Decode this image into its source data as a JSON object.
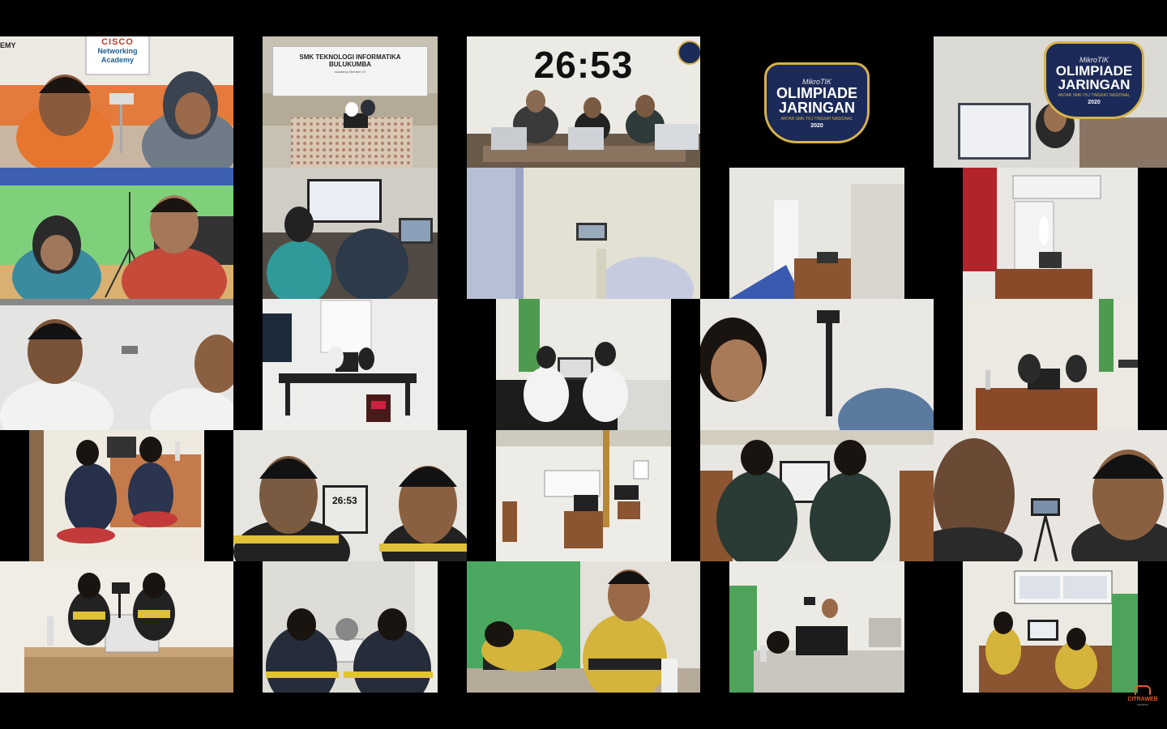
{
  "meeting": {
    "view": "gallery",
    "participant_count": 25
  },
  "timer": {
    "main": "26:53",
    "in_tile": "26:53"
  },
  "banners": {
    "school_line1": "SMK TEKNOLOGI INFORMATIKA",
    "school_line2": "BULUKUMBA",
    "school_line3": "Academy Member Of",
    "cisco_logo": "CISCO",
    "cisco_line1": "Networking",
    "cisco_line2": "Academy",
    "emy": "EMY"
  },
  "badge": {
    "brand": "MikroTIK",
    "line1": "OLIMPIADE",
    "line2": "JARINGAN",
    "sub": "ANTAR SMK-TKJ TINGKAT NASIONAL",
    "year": "2020"
  },
  "watermark": {
    "name": "CITRAWEB",
    "sub": "solution"
  },
  "colors": {
    "background": "#000000",
    "badge_navy": "#1b2a58",
    "badge_gold": "#d6b24a",
    "watermark": "#e35b2a"
  }
}
